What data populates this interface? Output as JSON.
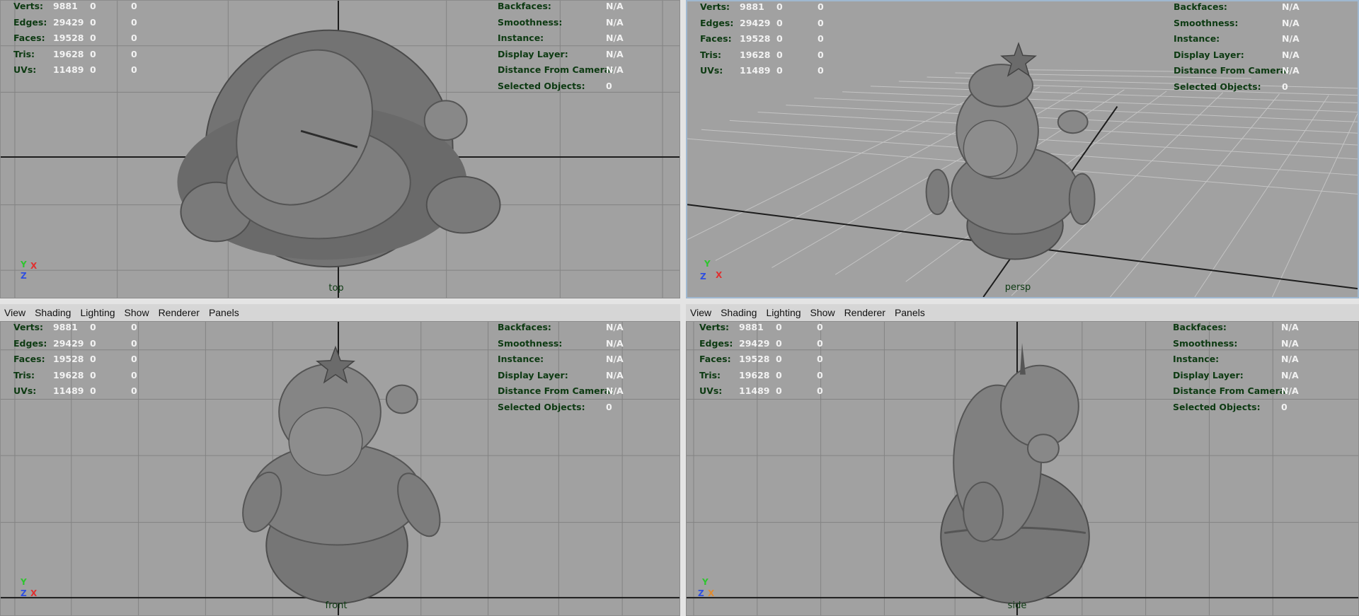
{
  "menu": [
    "View",
    "Shading",
    "Lighting",
    "Show",
    "Renderer",
    "Panels"
  ],
  "hud_left": [
    {
      "label": "Verts:",
      "value": "9881",
      "z1": "0",
      "z2": "0"
    },
    {
      "label": "Edges:",
      "value": "29429",
      "z1": "0",
      "z2": "0"
    },
    {
      "label": "Faces:",
      "value": "19528",
      "z1": "0",
      "z2": "0"
    },
    {
      "label": "Tris:",
      "value": "19628",
      "z1": "0",
      "z2": "0"
    },
    {
      "label": "UVs:",
      "value": "11489",
      "z1": "0",
      "z2": "0"
    }
  ],
  "hud_right": [
    {
      "label": "Backfaces:",
      "value": "N/A"
    },
    {
      "label": "Smoothness:",
      "value": "N/A"
    },
    {
      "label": "Instance:",
      "value": "N/A"
    },
    {
      "label": "Display Layer:",
      "value": "N/A"
    },
    {
      "label": "Distance From Camera:",
      "value": "N/A"
    },
    {
      "label": "Selected Objects:",
      "value": "0"
    }
  ],
  "views": {
    "top": {
      "camera": "top",
      "axes": [
        "Y",
        "Z",
        "X"
      ]
    },
    "persp": {
      "camera": "persp",
      "axes": [
        "Y",
        "Z",
        "X"
      ]
    },
    "front": {
      "camera": "front",
      "axes": [
        "Y",
        "Z",
        "X"
      ]
    },
    "side": {
      "camera": "side",
      "axes": [
        "Y",
        "Z",
        "X"
      ]
    }
  },
  "colors": {
    "viewport_bg": "#a1a1a1",
    "hud_label": "#0d3a12",
    "hud_value": "#f2f2f2",
    "grid": "#7a7a7a",
    "axis_line": "#1c1c1c",
    "model": "#6f6f6f"
  }
}
